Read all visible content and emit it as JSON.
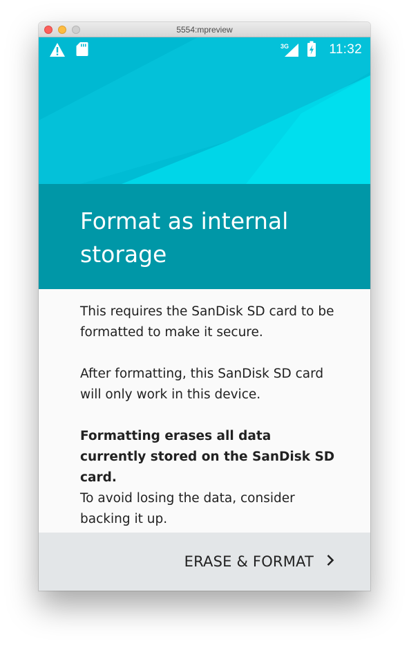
{
  "window": {
    "title": "5554:mpreview"
  },
  "status_bar": {
    "icons_left": [
      "warning-icon",
      "sd-card-icon"
    ],
    "icons_right": [
      "signal-3g-icon",
      "battery-charging-icon"
    ],
    "network_label": "3G",
    "time": "11:32"
  },
  "header": {
    "title": "Format as internal storage"
  },
  "body": {
    "paragraph_1": "This requires the SanDisk SD card to be formatted to make it secure.",
    "paragraph_2": "After formatting, this SanDisk SD card will only work in this device.",
    "warning_bold": "Formatting erases all data currently stored on the SanDisk SD card.",
    "warning_normal": "To avoid losing the data, consider backing it up."
  },
  "footer": {
    "action_label": "ERASE & FORMAT",
    "action_icon": "chevron-right-icon"
  },
  "colors": {
    "hero": "#00bcd4",
    "header_band": "#0097a7",
    "body_bg": "#fafafa",
    "footer_bg": "#e3e6e8",
    "text": "#212121"
  }
}
